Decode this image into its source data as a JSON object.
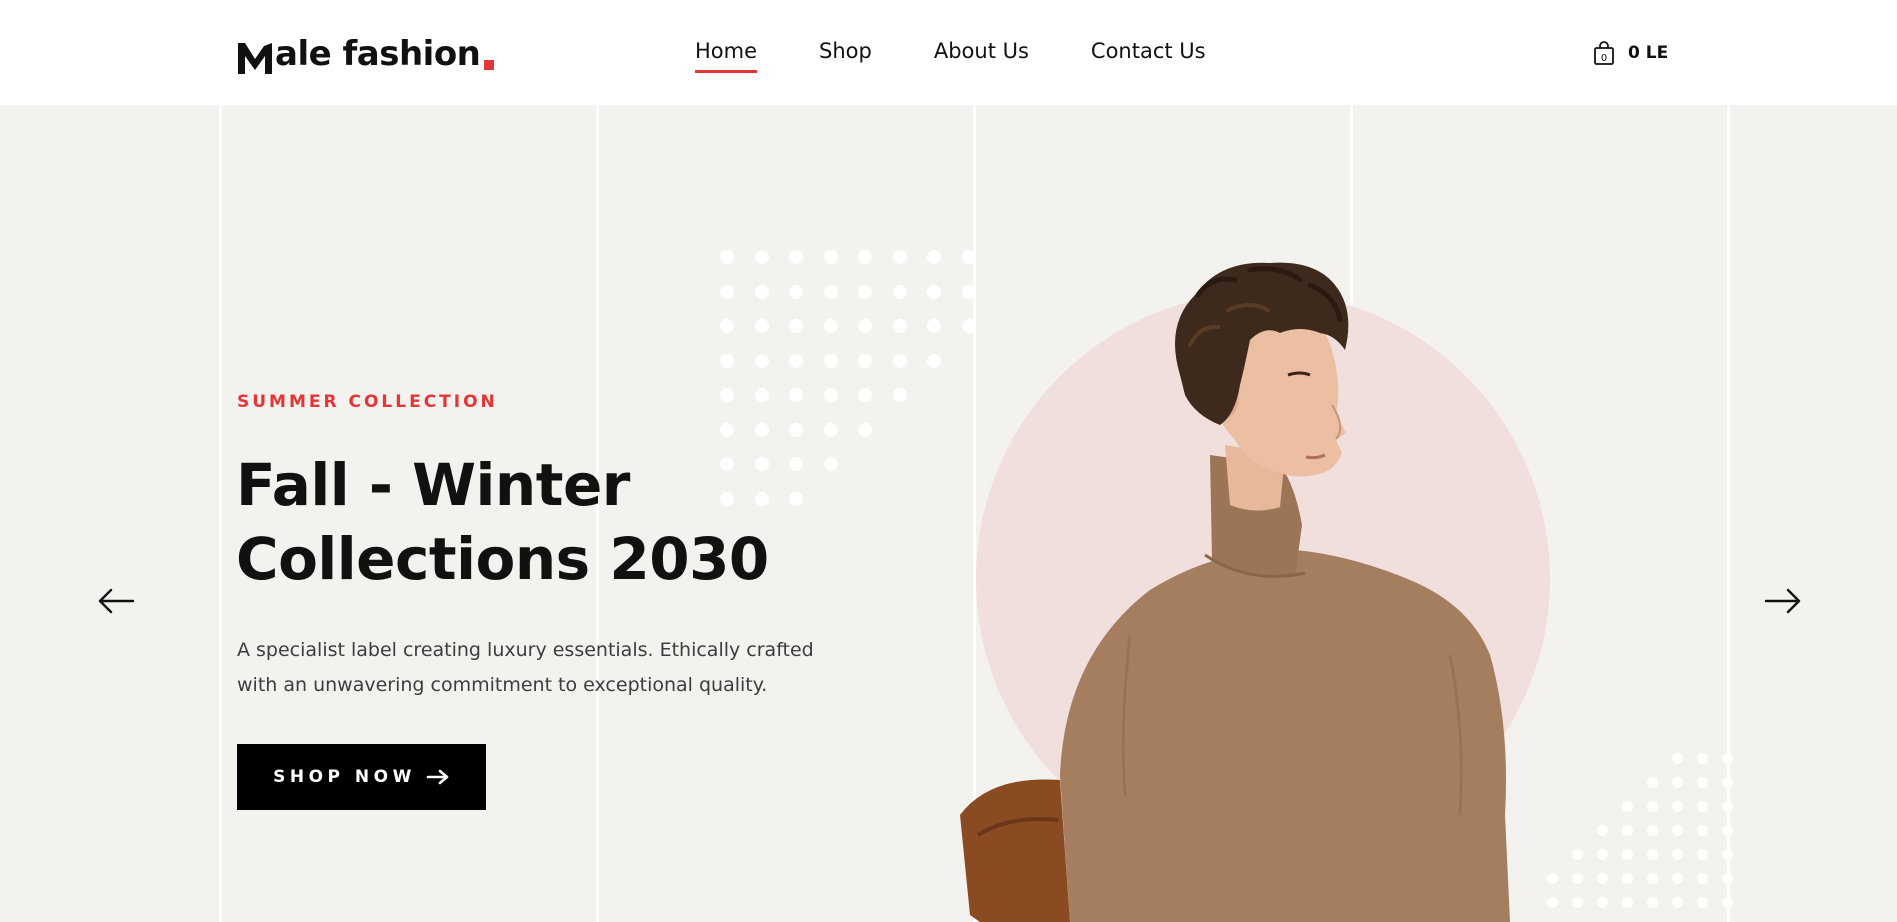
{
  "header": {
    "logo": {
      "letter_icon": "stylized-m-icon",
      "text": "ale fashion"
    },
    "nav": [
      {
        "label": "Home",
        "active": true
      },
      {
        "label": "Shop",
        "active": false
      },
      {
        "label": "About Us",
        "active": false
      },
      {
        "label": "Contact Us",
        "active": false
      }
    ],
    "cart": {
      "icon": "shopping-bag-icon",
      "badge": "0",
      "price": "0 LE"
    }
  },
  "hero": {
    "subtitle": "SUMMER COLLECTION",
    "title_line1": "Fall - Winter",
    "title_line2": "Collections 2030",
    "text_line1": "A specialist label creating luxury essentials. Ethically crafted",
    "text_line2": "with an unwavering commitment to exceptional quality.",
    "button": {
      "label": "SHOP NOW",
      "icon": "arrow-right-icon"
    },
    "prev_icon": "arrow-left-icon",
    "next_icon": "arrow-right-icon",
    "image": "model-in-brown-turtleneck-illustration"
  },
  "colors": {
    "accent": "#e53637",
    "hero_background": "#f3f2ee",
    "circle": "#f1dfde",
    "sweater": "#a57e5f",
    "button": "#000000"
  }
}
